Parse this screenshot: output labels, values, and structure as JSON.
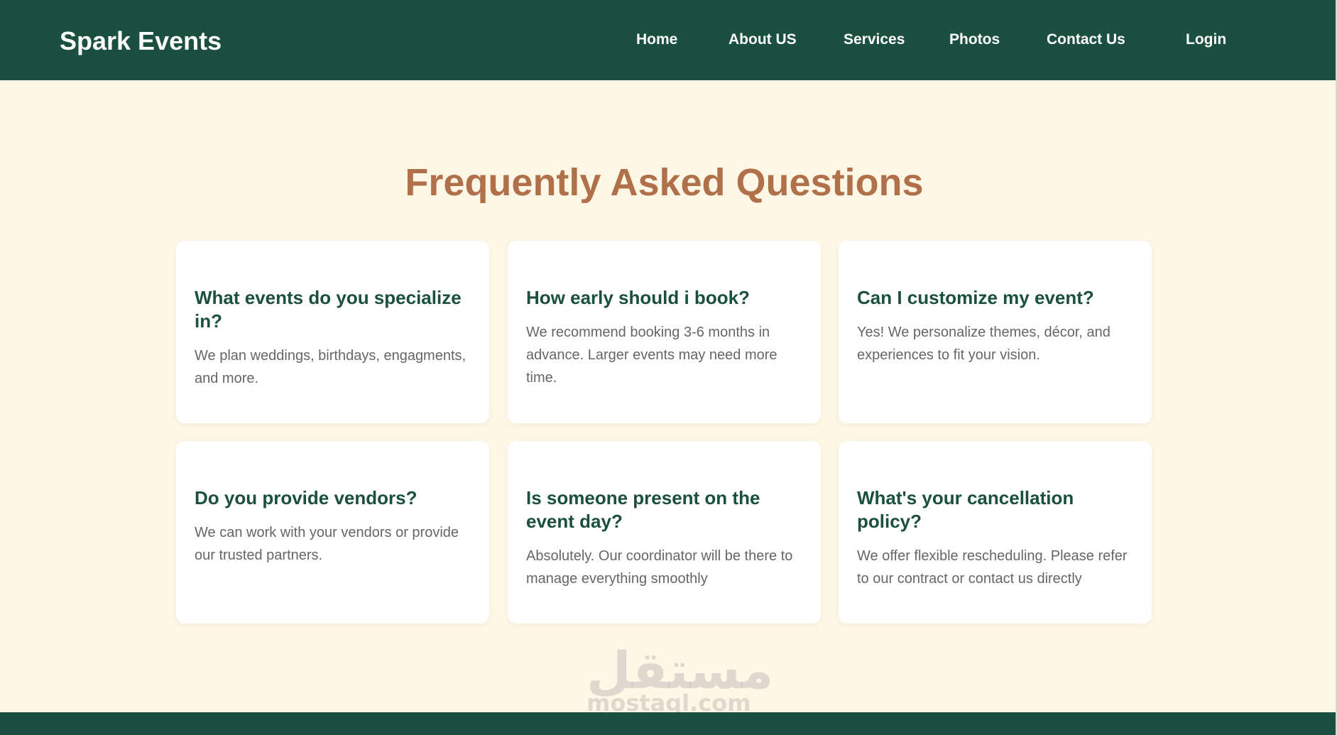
{
  "header": {
    "brand": "Spark Events",
    "nav": [
      "Home",
      "About US",
      "Services",
      "Photos",
      "Contact Us",
      "Login"
    ]
  },
  "main": {
    "title": "Frequently Asked Questions",
    "faqs": [
      {
        "question": "What events do you specialize in?",
        "answer": "We plan weddings, birthdays, engagments, and more."
      },
      {
        "question": "How early should i book?",
        "answer": "We recommend booking 3-6 months in advance. Larger events may need more time."
      },
      {
        "question": "Can I customize my event?",
        "answer": "Yes! We personalize themes, décor, and experiences to fit your vision."
      },
      {
        "question": "Do you provide vendors?",
        "answer": "We can work with your vendors or provide our trusted partners."
      },
      {
        "question": "Is someone present on the event day?",
        "answer": "Absolutely. Our coordinator will be there to manage everything smoothly"
      },
      {
        "question": "What's your cancellation policy?",
        "answer": "We offer flexible rescheduling. Please refer to our contract or contact us directly"
      }
    ]
  },
  "watermark": {
    "arabic": "مستقل",
    "latin": "mostaql.com"
  },
  "colors": {
    "header_bg": "#1b4f40",
    "page_bg": "#fff7e6",
    "title": "#b0714a",
    "question": "#1b4f40",
    "answer": "#666666"
  }
}
